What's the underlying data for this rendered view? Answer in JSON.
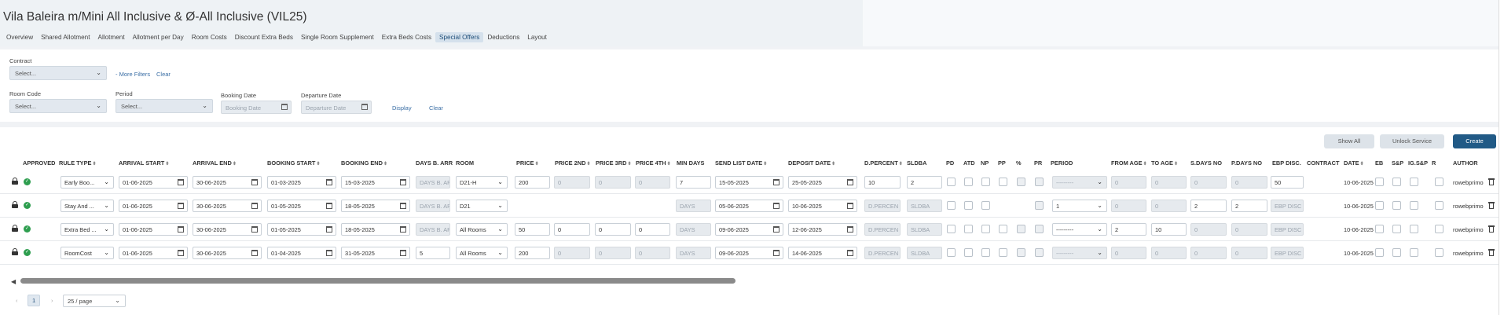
{
  "title": "Vila Baleira m/Mini All Inclusive & Ø-All Inclusive (VIL25)",
  "tabs": [
    "Overview",
    "Shared Allotment",
    "Allotment",
    "Allotment per Day",
    "Room Costs",
    "Discount Extra Beds",
    "Single Room Supplement",
    "Extra Beds Costs",
    "Special Offers",
    "Deductions",
    "Layout"
  ],
  "active_tab": "Special Offers",
  "filters": {
    "contract_label": "Contract",
    "contract_value": "Select...",
    "more_filters": "- More Filters",
    "clear_top": "Clear",
    "room_code_label": "Room Code",
    "room_code_value": "Select...",
    "period_label": "Period",
    "period_value": "Select...",
    "booking_date_label": "Booking Date",
    "booking_date_placeholder": "Booking Date",
    "departure_date_label": "Departure Date",
    "departure_date_placeholder": "Departure Date",
    "display": "Display",
    "clear": "Clear"
  },
  "buttons": {
    "show_all": "Show All",
    "unlock_service": "Unlock Service",
    "create": "Create"
  },
  "columns": [
    "APPROVED",
    "RULE TYPE",
    "ARRIVAL START",
    "ARRIVAL END",
    "BOOKING START",
    "BOOKING END",
    "DAYS B. ARR",
    "ROOM",
    "PRICE",
    "PRICE 2ND",
    "PRICE 3RD",
    "PRICE 4TH",
    "MIN DAYS",
    "SEND LIST DATE",
    "DEPOSIT DATE",
    "D.PERCENT",
    "SLDBA",
    "PD",
    "ATD",
    "NP",
    "PP",
    "%",
    "PR",
    "PERIOD",
    "FROM AGE",
    "TO AGE",
    "S.DAYS NO",
    "P.DAYS NO",
    "EBP DISC.",
    "CONTRACT",
    "DATE",
    "EB",
    "S&P",
    "IG.S&P",
    "R",
    "AUTHOR"
  ],
  "rows": [
    {
      "rule_type": "Early Boo...",
      "arrival_start": "01-06-2025",
      "arrival_end": "30-06-2025",
      "booking_start": "01-03-2025",
      "booking_end": "15-03-2025",
      "days_b_arr": "DAYS B. AR",
      "room": "D21-H",
      "price": "200",
      "price2": "0",
      "price3": "0",
      "price4": "0",
      "min_days": "7",
      "send_list_date": "15-05-2025",
      "deposit_date": "25-05-2025",
      "d_percent": "10",
      "sldba": "2",
      "period": "---------",
      "from_age": "0",
      "to_age": "0",
      "s_days_no": "0",
      "p_days_no": "0",
      "ebp_disc": "50",
      "date": "10-06-2025",
      "author": "rowebprimo"
    },
    {
      "rule_type": "Stay And ...",
      "arrival_start": "01-06-2025",
      "arrival_end": "30-06-2025",
      "booking_start": "01-05-2025",
      "booking_end": "18-05-2025",
      "days_b_arr": "DAYS B. AR",
      "room": "D21",
      "min_days": "DAYS",
      "send_list_date": "05-06-2025",
      "deposit_date": "10-06-2025",
      "d_percent": "D.PERCEN",
      "sldba": "SLDBA",
      "period": "1",
      "from_age": "0",
      "to_age": "0",
      "s_days_no": "2",
      "p_days_no": "2",
      "ebp_disc": "EBP DISC",
      "date": "10-06-2025",
      "author": "rowebprimo"
    },
    {
      "rule_type": "Extra Bed ...",
      "arrival_start": "01-06-2025",
      "arrival_end": "30-06-2025",
      "booking_start": "01-05-2025",
      "booking_end": "18-05-2025",
      "days_b_arr": "DAYS B. AR",
      "room": "All Rooms",
      "price": "50",
      "price2": "0",
      "price3": "0",
      "price4": "0",
      "min_days": "DAYS",
      "send_list_date": "09-06-2025",
      "deposit_date": "12-06-2025",
      "d_percent": "D.PERCEN",
      "sldba": "SLDBA",
      "period": "---------",
      "from_age": "2",
      "to_age": "10",
      "s_days_no": "0",
      "p_days_no": "0",
      "ebp_disc": "EBP DISC",
      "date": "10-06-2025",
      "author": "rowebprimo"
    },
    {
      "rule_type": "RoomCost",
      "arrival_start": "01-06-2025",
      "arrival_end": "30-06-2025",
      "booking_start": "01-04-2025",
      "booking_end": "31-05-2025",
      "days_b_arr": "5",
      "room": "All Rooms",
      "price": "200",
      "price2": "0",
      "price3": "0",
      "price4": "0",
      "min_days": "DAYS",
      "send_list_date": "09-06-2025",
      "deposit_date": "14-06-2025",
      "d_percent": "D.PERCEN",
      "sldba": "SLDBA",
      "period": "---------",
      "from_age": "0",
      "to_age": "0",
      "s_days_no": "0",
      "p_days_no": "0",
      "ebp_disc": "EBP DISC",
      "date": "10-06-2025",
      "author": "rowebprimo"
    }
  ],
  "pagination": {
    "current": "1",
    "page_size": "25 / page",
    "prev": "‹",
    "next": "›"
  }
}
